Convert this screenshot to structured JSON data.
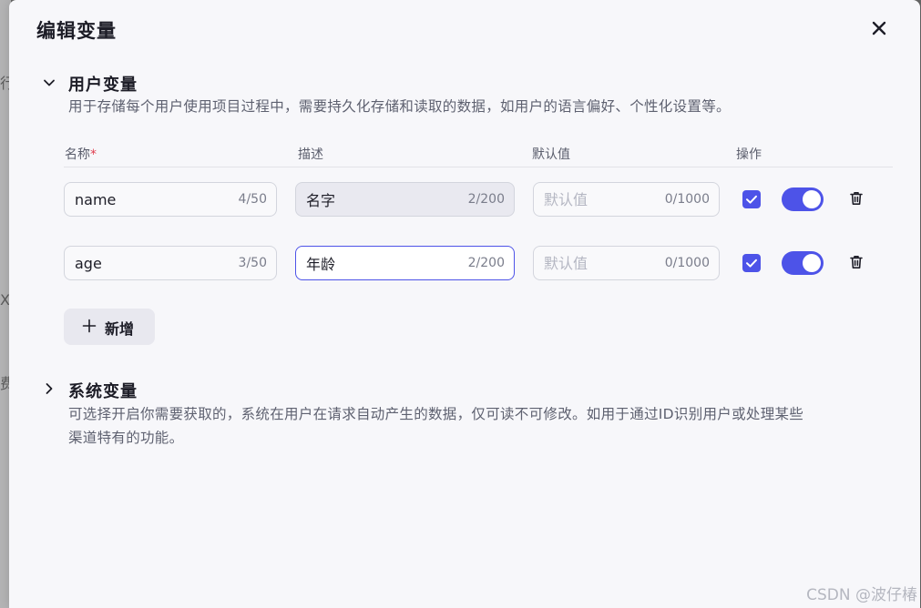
{
  "background": {
    "fragments": [
      "行",
      "X]",
      "费"
    ]
  },
  "dialog": {
    "title": "编辑变量",
    "close_icon": "close-icon"
  },
  "user_section": {
    "title": "用户变量",
    "expanded": true,
    "description": "用于存储每个用户使用项目过程中，需要持久化存储和读取的数据，如用户的语言偏好、个性化设置等。",
    "columns": {
      "name": "名称",
      "required_mark": "*",
      "description": "描述",
      "default": "默认值",
      "actions": "操作"
    },
    "rows": [
      {
        "name": "name",
        "name_count": "4/50",
        "description": "名字",
        "description_count": "2/200",
        "default_placeholder": "默认值",
        "default_count": "0/1000",
        "checked": true,
        "enabled": true
      },
      {
        "name": "age",
        "name_count": "3/50",
        "description": "年龄",
        "description_count": "2/200",
        "default_placeholder": "默认值",
        "default_count": "0/1000",
        "checked": true,
        "enabled": true
      }
    ],
    "add_label": "新增"
  },
  "system_section": {
    "title": "系统变量",
    "expanded": false,
    "description_line1": "可选择开启你需要获取的，系统在用户在请求自动产生的数据，仅可读不可修改。如用于通过ID识别用户或处理某些",
    "description_line2": "渠道特有的功能。"
  },
  "watermark": "CSDN @波仔椿",
  "colors": {
    "accent": "#4d53e8",
    "required": "#e03e4f",
    "panel": "#f7f7fa"
  }
}
